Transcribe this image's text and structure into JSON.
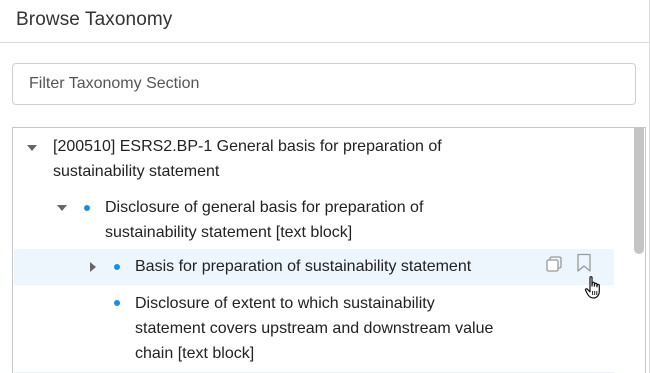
{
  "panel": {
    "title": "Browse Taxonomy"
  },
  "filter": {
    "placeholder": "Filter Taxonomy Section",
    "value": ""
  },
  "tree": {
    "nodes": [
      {
        "label_line1": "[200510] ESRS2.BP-1 General basis for preparation of",
        "label_line2": "sustainability statement",
        "expanded": true
      },
      {
        "label_line1": "Disclosure of general basis for preparation of",
        "label_line2": "sustainability statement [text block]",
        "expanded": true
      },
      {
        "label_line1": "Basis for preparation of sustainability statement",
        "expanded": false,
        "hovered": true
      },
      {
        "label_line1": "Disclosure of extent to which sustainability",
        "label_line2": "statement covers upstream and downstream value",
        "label_line3": "chain [text block]"
      }
    ]
  },
  "icons": {
    "copy": "copy-icon",
    "bookmark": "bookmark-icon",
    "cursor": "hand-pointer-cursor"
  },
  "colors": {
    "bullet": "#1a8fe0",
    "hover_row": "#eef6fd",
    "scrollbar": "#c4c4c4"
  }
}
